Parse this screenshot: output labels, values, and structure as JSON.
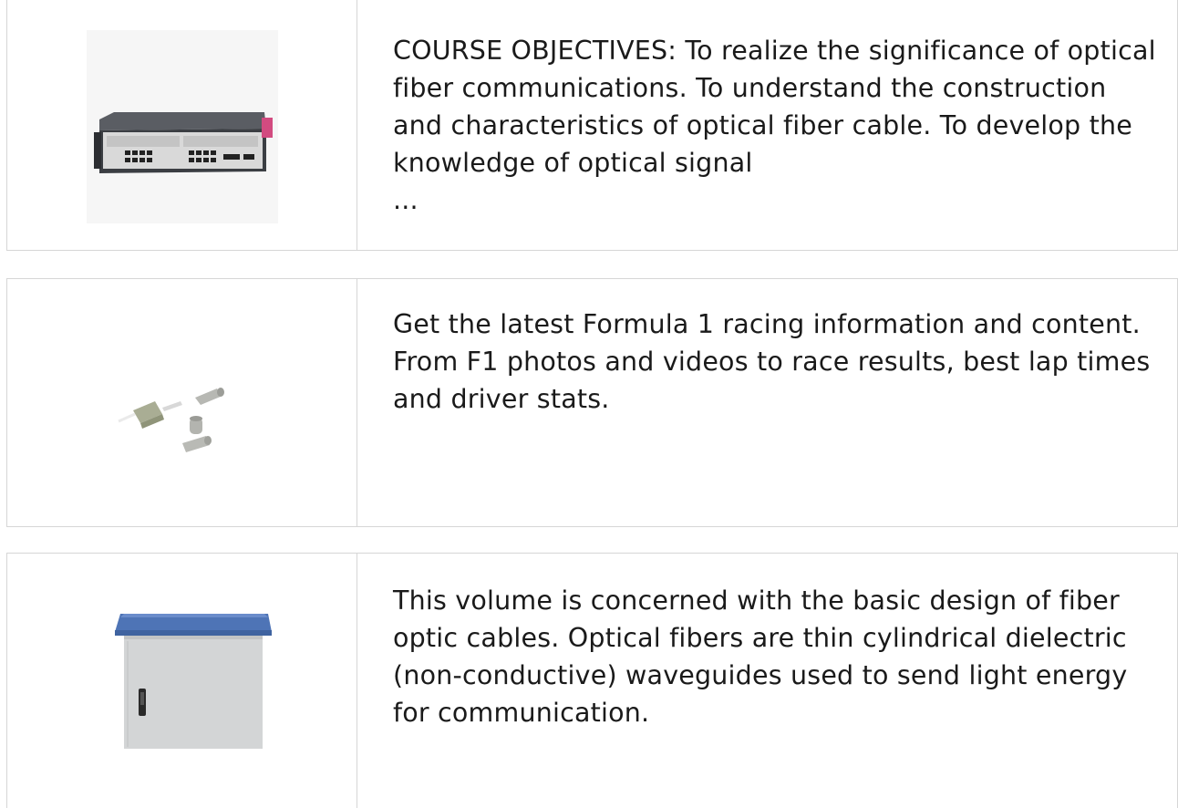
{
  "results": [
    {
      "image_icon": "olt-chassis-image",
      "text": "COURSE OBJECTIVES: To realize the significance of optical fiber communications. To understand the construction and characteristics of optical fiber cable. To develop the knowledge of optical signal",
      "ellipsis": "..."
    },
    {
      "image_icon": "lc-fiber-connector-image",
      "text": "Get the latest Formula 1 racing information and content. From F1 photos and videos to race results, best lap times and driver stats."
    },
    {
      "image_icon": "outdoor-cabinet-image",
      "text": "This volume is concerned with the basic design of fiber optic cables. Optical fibers are thin cylindrical dielectric (non-conductive) waveguides used to send light energy for communication."
    }
  ],
  "colors": {
    "border": "#d6d6d6",
    "text": "#1a1a1a",
    "cabinet_top": "#4e74b6",
    "cabinet_body": "#d3d5d6"
  }
}
